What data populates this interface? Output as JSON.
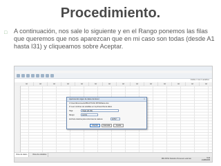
{
  "slide": {
    "title": "Procedimiento.",
    "bullet_icon": "square-bullet-icon",
    "paragraph": "A continuación, nos sale lo siguiente y en el Rango ponemos las filas que queremos que nos aparezcan que en mi caso son todas (desde A1 hasta I31) y cliqueamos sobre Aceptar."
  },
  "screenshot": {
    "visible_label": "Visible: 0 de 0 variables",
    "columns": [
      "var",
      "var",
      "var",
      "var",
      "var",
      "var",
      "var",
      "var",
      "var",
      "var",
      "var",
      "var",
      "var",
      "var"
    ],
    "tabs": [
      "Vista de datos",
      "Vista de variables"
    ],
    "status_text": "IBM SPSS Statistics Processor está listo",
    "clock_time": "9:44",
    "clock_date": "21/08/2015",
    "dialog": {
      "title": "Apertura del origen de datos de Excel",
      "file_line": "C:\\Users\\Documents\\PRACTICAS SPSS\\Datos.xlsx",
      "checkbox_label": "Leer nombres de variables en la primera fila de datos",
      "sheet_label": "Hoja:",
      "sheet_value": "Hoja1 [A1:I31]",
      "range_label": "Rango:",
      "range_value": "A1:I31",
      "maxwidth_label": "Anchura máxima para columnas de cadena:",
      "maxwidth_value": "32767",
      "ok_label": "Aceptar",
      "cancel_label": "Cancelar",
      "help_label": "Ayuda"
    }
  }
}
